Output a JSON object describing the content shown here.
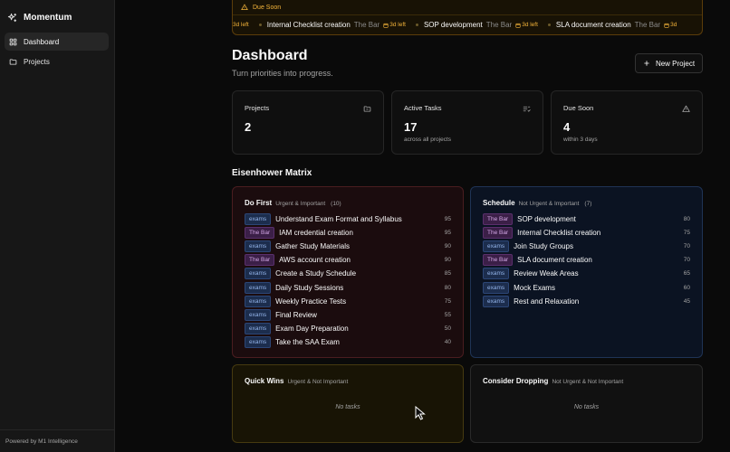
{
  "app": {
    "name": "Momentum",
    "footer": "Powered by M1 Intelligence"
  },
  "sidebar": {
    "items": [
      {
        "label": "Dashboard",
        "icon": "dashboard-icon",
        "active": true
      },
      {
        "label": "Projects",
        "icon": "folder-icon",
        "active": false
      }
    ]
  },
  "due_soon": {
    "label": "Due Soon",
    "items": [
      {
        "prefix_days": "3d left"
      },
      {
        "title": "Internal Checklist creation",
        "project": "The Bar",
        "days": "3d left"
      },
      {
        "title": "SOP development",
        "project": "The Bar",
        "days": "3d left"
      },
      {
        "title": "SLA document creation",
        "project": "The Bar",
        "days": "3d"
      }
    ]
  },
  "header": {
    "title": "Dashboard",
    "subtitle": "Turn priorities into progress.",
    "new_project_label": "New Project"
  },
  "stats": [
    {
      "label": "Projects",
      "value": "2",
      "note": "",
      "icon": "folder-icon"
    },
    {
      "label": "Active Tasks",
      "value": "17",
      "note": "across all projects",
      "icon": "list-check-icon"
    },
    {
      "label": "Due Soon",
      "value": "4",
      "note": "within 3 days",
      "icon": "warning-icon"
    }
  ],
  "matrix": {
    "title": "Eisenhower Matrix",
    "do_first": {
      "title": "Do First",
      "subtitle": "Urgent & Important",
      "count": "(10)",
      "tasks": [
        {
          "tag": "exams",
          "title": "Understand Exam Format and Syllabus",
          "score": "95"
        },
        {
          "tag": "The Bar",
          "title": "IAM credential creation",
          "score": "95"
        },
        {
          "tag": "exams",
          "title": "Gather Study Materials",
          "score": "90"
        },
        {
          "tag": "The Bar",
          "title": "AWS account creation",
          "score": "90"
        },
        {
          "tag": "exams",
          "title": "Create a Study Schedule",
          "score": "85"
        },
        {
          "tag": "exams",
          "title": "Daily Study Sessions",
          "score": "80"
        },
        {
          "tag": "exams",
          "title": "Weekly Practice Tests",
          "score": "75"
        },
        {
          "tag": "exams",
          "title": "Final Review",
          "score": "55"
        },
        {
          "tag": "exams",
          "title": "Exam Day Preparation",
          "score": "50"
        },
        {
          "tag": "exams",
          "title": "Take the SAA Exam",
          "score": "40"
        }
      ]
    },
    "schedule": {
      "title": "Schedule",
      "subtitle": "Not Urgent & Important",
      "count": "(7)",
      "tasks": [
        {
          "tag": "The Bar",
          "title": "SOP development",
          "score": "80"
        },
        {
          "tag": "The Bar",
          "title": "Internal Checklist creation",
          "score": "75"
        },
        {
          "tag": "exams",
          "title": "Join Study Groups",
          "score": "70"
        },
        {
          "tag": "The Bar",
          "title": "SLA document creation",
          "score": "70"
        },
        {
          "tag": "exams",
          "title": "Review Weak Areas",
          "score": "65"
        },
        {
          "tag": "exams",
          "title": "Mock Exams",
          "score": "60"
        },
        {
          "tag": "exams",
          "title": "Rest and Relaxation",
          "score": "45"
        }
      ]
    },
    "quick_wins": {
      "title": "Quick Wins",
      "subtitle": "Urgent & Not Important",
      "empty": "No tasks"
    },
    "consider_dropping": {
      "title": "Consider Dropping",
      "subtitle": "Not Urgent & Not Important",
      "empty": "No tasks"
    }
  },
  "colors": {
    "amber": "#f5b53a",
    "tag_exams": "#93b4ea",
    "tag_bar": "#d3a7e6"
  }
}
